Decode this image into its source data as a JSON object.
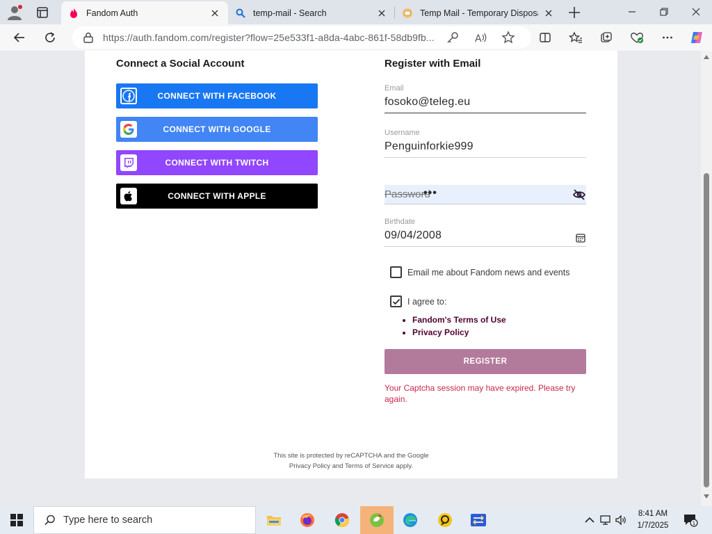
{
  "browser": {
    "tabs": [
      {
        "title": "Fandom Auth",
        "active": true
      },
      {
        "title": "temp-mail - Search",
        "active": false
      },
      {
        "title": "Temp Mail - Temporary Disposab",
        "active": false
      }
    ],
    "url": "https://auth.fandom.com/register?flow=25e533f1-a8da-4abc-861f-58db9fb..."
  },
  "page": {
    "social_title": "Connect a Social Account",
    "email_title": "Register with Email",
    "social_buttons": {
      "facebook": "CONNECT WITH FACEBOOK",
      "google": "CONNECT WITH GOOGLE",
      "twitch": "CONNECT WITH TWITCH",
      "apple": "CONNECT WITH APPLE"
    },
    "email": {
      "label": "Email",
      "value": "fosoko@teleg.eu"
    },
    "username": {
      "label": "Username",
      "value": "Penguinforkie999"
    },
    "password": {
      "placeholder": "Password",
      "value": "•••"
    },
    "birthdate": {
      "label": "Birthdate",
      "value": "09/04/2008"
    },
    "newsletter": {
      "label": "Email me about Fandom news and events",
      "checked": false
    },
    "agree": {
      "label": "I agree to:",
      "checked": true
    },
    "terms": [
      "Fandom's Terms of Use",
      "Privacy Policy"
    ],
    "register_label": "REGISTER",
    "error": "Your Captcha session may have expired. Please try again.",
    "recaptcha": {
      "line1": "This site is protected by reCAPTCHA and the Google",
      "privacy": "Privacy Policy",
      "and": "and",
      "terms": "Terms of Service",
      "apply": "apply."
    }
  },
  "taskbar": {
    "search_placeholder": "Type here to search",
    "time": "8:41 AM",
    "date": "1/7/2025"
  },
  "colors": {
    "facebook": "#1877f2",
    "google": "#4285f4",
    "twitch": "#9146ff",
    "apple": "#000000",
    "register": "#b37b9b",
    "error": "#c8264b",
    "terms_link": "#520032"
  }
}
